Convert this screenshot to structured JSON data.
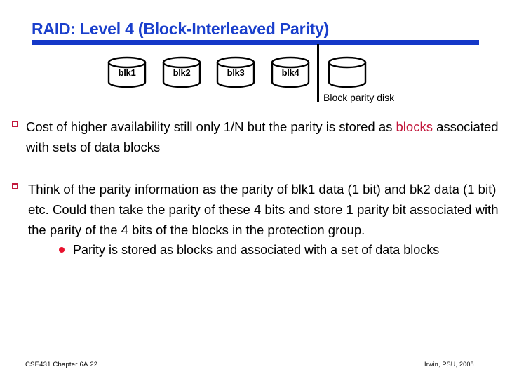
{
  "slide": {
    "title": "RAID: Level 4 (Block-Interleaved Parity)",
    "accent_color": "#1A3FCC",
    "rule_color": "#1438C8",
    "highlight_color": "#C2183C",
    "sub_bullet_color": "#E8112D"
  },
  "diagram": {
    "name": "raid-4-disk-array",
    "data_disks": [
      {
        "label": "blk1"
      },
      {
        "label": "blk2"
      },
      {
        "label": "blk3"
      },
      {
        "label": "blk4"
      }
    ],
    "parity_disk": {
      "label": ""
    },
    "parity_caption": "Block parity disk",
    "divider": "vertical-separator"
  },
  "bullets": [
    {
      "level": 1,
      "marker": "hollow-square",
      "text_before": "Cost of higher availability still only 1/N but the parity is stored as ",
      "highlight": "blocks",
      "text_after": " associated with sets of data blocks"
    },
    {
      "level": 1,
      "marker": "hollow-square",
      "text": "Think of the parity information as the parity of  blk1 data (1 bit) and bk2 data (1 bit) etc.  Could then take the parity of these 4 bits and store 1 parity bit associated with the parity of the 4 bits of the blocks in the protection group."
    },
    {
      "level": 2,
      "marker": "filled-circle",
      "text": "Parity is stored as blocks and associated with a set of data blocks"
    }
  ],
  "footer": {
    "left": "CSE431 Chapter 6A.22",
    "right": "Irwin, PSU, 2008"
  }
}
